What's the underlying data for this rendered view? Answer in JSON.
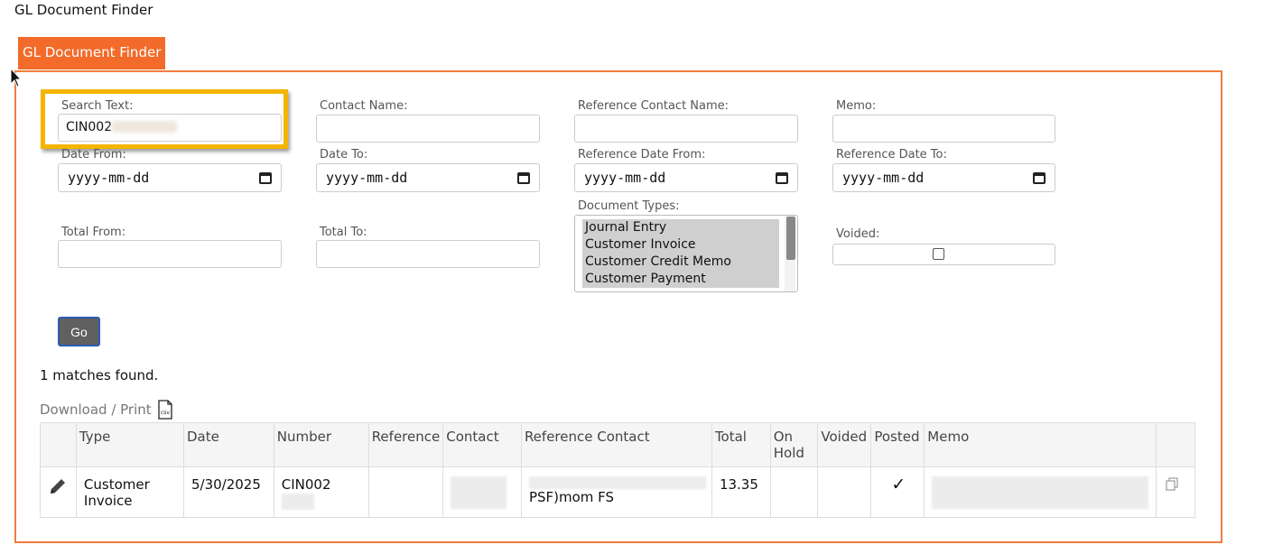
{
  "page_title": "GL Document Finder",
  "tab_label": "GL Document Finder",
  "form": {
    "search_text_label": "Search Text:",
    "search_text_value": "CIN002",
    "contact_name_label": "Contact Name:",
    "reference_contact_name_label": "Reference Contact Name:",
    "memo_label": "Memo:",
    "date_from_label": "Date From:",
    "date_to_label": "Date To:",
    "reference_date_from_label": "Reference Date From:",
    "reference_date_to_label": "Reference Date To:",
    "date_placeholder": "yyyy-mm-dd",
    "document_types_label": "Document Types:",
    "document_types": [
      "Journal Entry",
      "Customer Invoice",
      "Customer Credit Memo",
      "Customer Payment"
    ],
    "total_from_label": "Total From:",
    "total_to_label": "Total To:",
    "voided_label": "Voided:",
    "go_label": "Go"
  },
  "results": {
    "matches_text": "1 matches found.",
    "download_label": "Download / Print",
    "download_icon": "csv-file-icon",
    "columns": {
      "type": "Type",
      "date": "Date",
      "number": "Number",
      "reference": "Reference",
      "contact": "Contact",
      "reference_contact": "Reference Contact",
      "total": "Total",
      "on_hold": "On Hold",
      "voided": "Voided",
      "posted": "Posted",
      "memo": "Memo"
    },
    "rows": [
      {
        "type": "Customer Invoice",
        "date": "5/30/2025",
        "number": "CIN002",
        "reference": "",
        "reference_contact": "PSF)mom FS",
        "total": "13.35",
        "posted_mark": "✓"
      }
    ]
  },
  "colors": {
    "accent": "#f26b2a",
    "panel_border": "#ef7d3e",
    "highlight": "#f4b400",
    "go_button": "#606060"
  }
}
